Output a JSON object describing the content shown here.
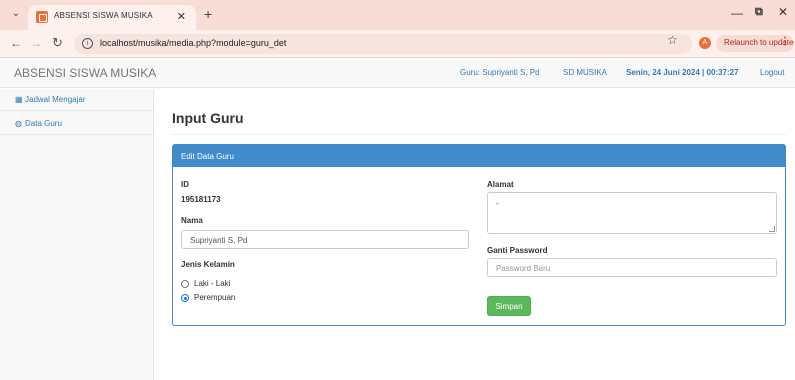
{
  "browser": {
    "tab_title": "ABSENSI SISWA MUSIKA",
    "tab_close": "✕",
    "new_tab": "+",
    "url": "localhost/musika/media.php?module=guru_det",
    "profile_initial": "A",
    "relaunch_label": "Relaunch to update",
    "icons": [
      "tab-menu-icon",
      "back-icon",
      "forward-icon",
      "reload-icon",
      "site-info-icon",
      "bookmark-star-icon",
      "minimize-icon",
      "maximize-icon",
      "close-icon"
    ]
  },
  "header": {
    "brand": "ABSENSI SISWA MUSIKA",
    "guru": "Guru: Supriyanti S, Pd",
    "school": "SD MUSIKA",
    "datetime": "Senin, 24 Juni 2024 | 00:37:27",
    "logout": "Logout"
  },
  "sidebar": {
    "items": [
      {
        "label": "Jadwal Mengajar",
        "icon": "table-icon"
      },
      {
        "label": "Data Guru",
        "icon": "users-icon"
      }
    ]
  },
  "main": {
    "page_title": "Input Guru",
    "panel_title": "Edit Data Guru",
    "fields": {
      "id_label": "ID",
      "id_value": "195181173",
      "nama_label": "Nama",
      "nama_value": "Supriyanti S, Pd",
      "jk_label": "Jenis Kelamin",
      "jk_options": [
        "Laki - Laki",
        "Perempuan"
      ],
      "jk_selected": "Perempuan",
      "alamat_label": "Alamat",
      "alamat_value": "-",
      "password_label": "Ganti Password",
      "password_placeholder": "Password Baru"
    },
    "save_button": "Simpan"
  },
  "colors": {
    "primary": "#428bca",
    "link": "#337ab7",
    "success": "#5cb85c",
    "tabbar": "#f8dcd6"
  }
}
